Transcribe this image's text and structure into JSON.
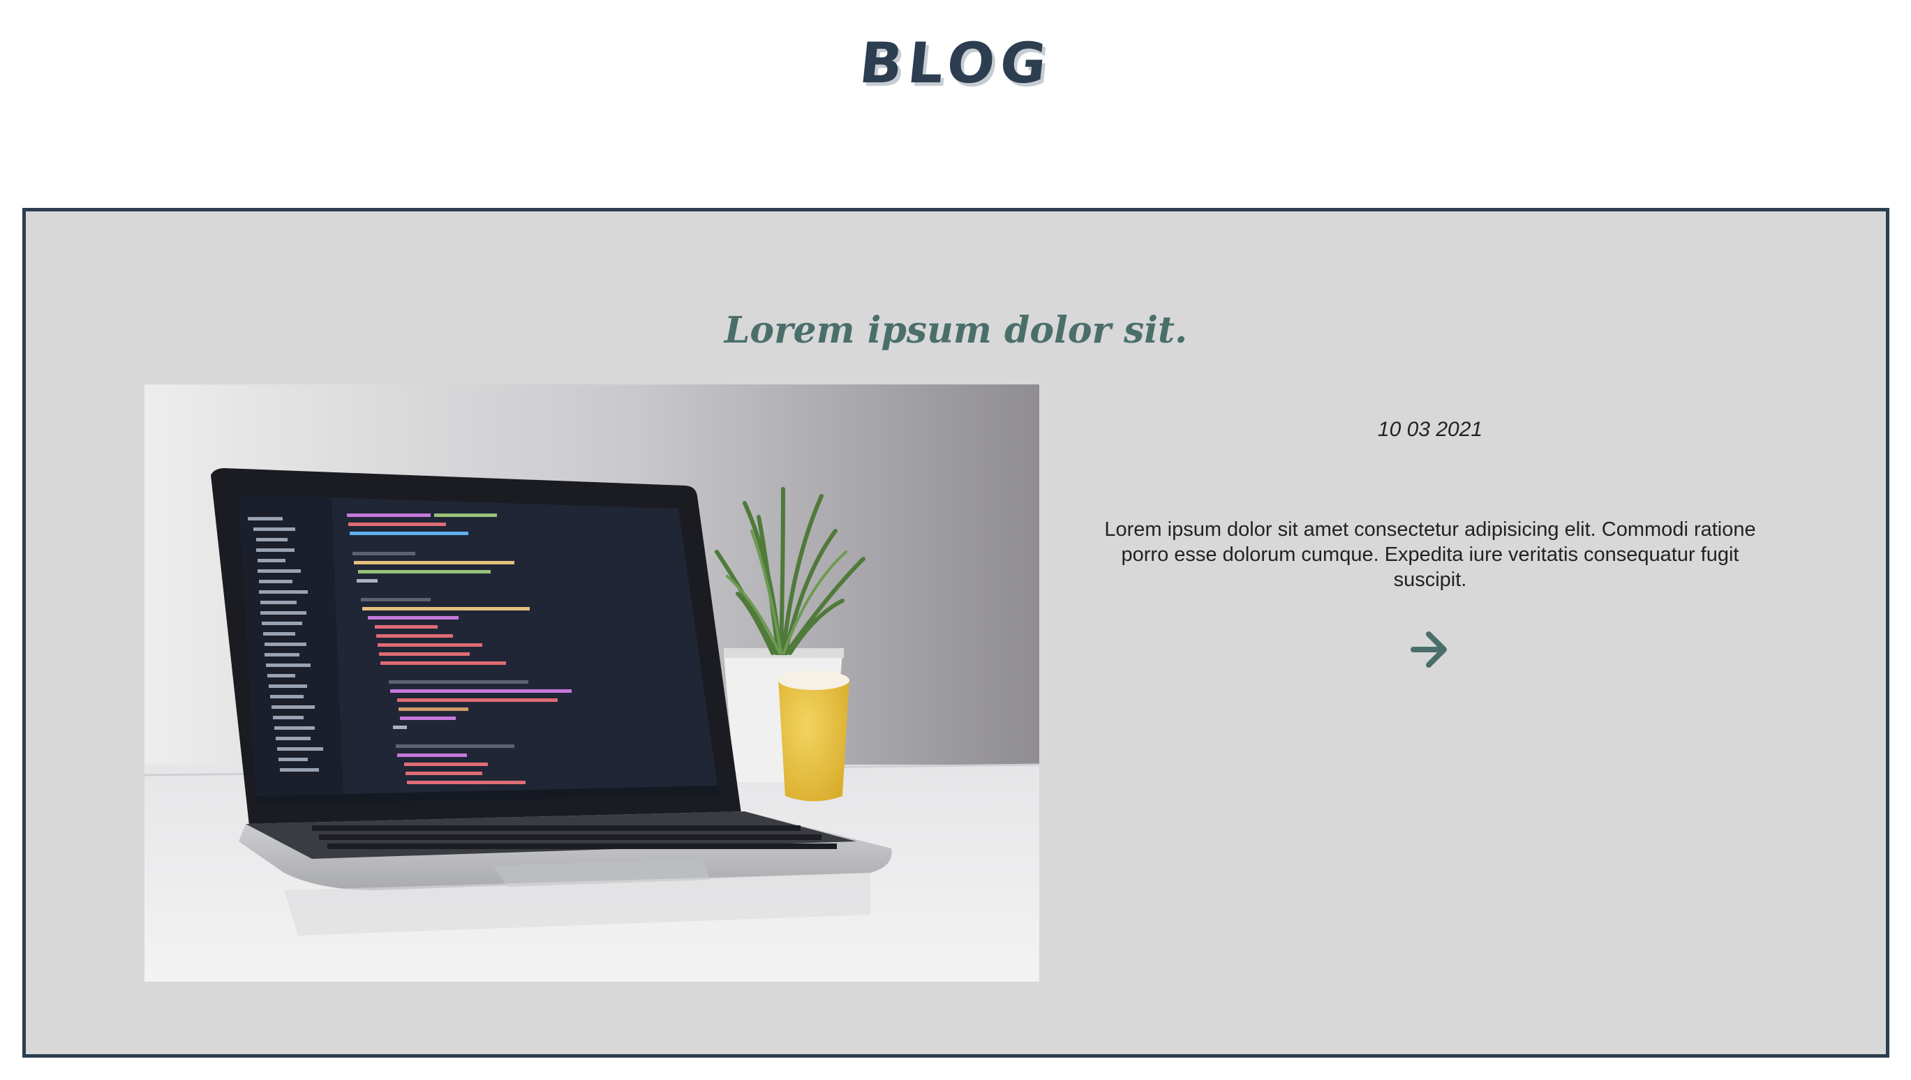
{
  "header": {
    "site_title": "BLOG"
  },
  "post": {
    "title": "Lorem ipsum dolor sit.",
    "date": "10 03 2021",
    "excerpt": "Lorem ipsum dolor sit amet consectetur adipisicing elit. Commodi ratione porro esse dolorum cumque. Expedita iure veritatis consequatur fugit suscipit.",
    "image_description": "laptop-with-code-editor-photo",
    "read_more_icon": "arrow-right-icon"
  },
  "colors": {
    "brand_dark": "#2c3e50",
    "title_teal": "#4a6f6b",
    "card_background": "#d8d8d8"
  }
}
